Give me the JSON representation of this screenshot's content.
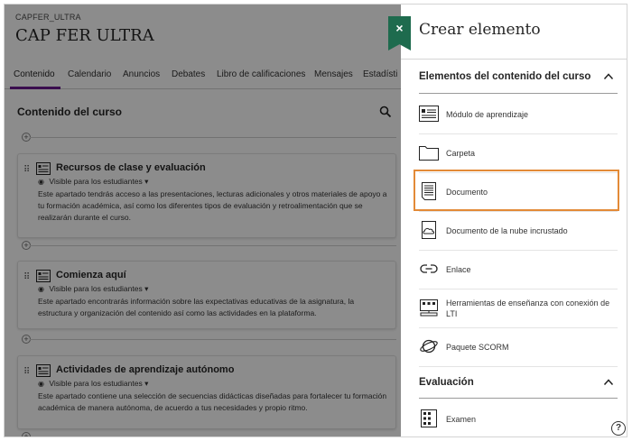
{
  "course": {
    "code": "CAPFER_ULTRA",
    "title": "CAP FER ULTRA",
    "nav": [
      "Contenido",
      "Calendario",
      "Anuncios",
      "Debates",
      "Libro de calificaciones",
      "Mensajes",
      "Estadísti"
    ],
    "section_title": "Contenido del curso",
    "items": [
      {
        "title": "Recursos de clase y evaluación",
        "visibility": "Visible para los estudiantes",
        "description": "Este apartado tendrás acceso a las presentaciones, lecturas adicionales y otros materiales de apoyo a tu formación académica, así como los diferentes tipos de evaluación y retroalimentación que se realizarán durante el curso."
      },
      {
        "title": "Comienza aquí",
        "visibility": "Visible para los estudiantes",
        "description": "Este apartado encontrarás información sobre las expectativas educativas de la asignatura, la estructura y organización del contenido así como las actividades en la plataforma."
      },
      {
        "title": "Actividades de aprendizaje autónomo",
        "visibility": "Visible para los estudiantes",
        "description": "Este apartado contiene una selección de secuencias didácticas diseñadas para fortalecer tu formación académica de manera autónoma, de acuerdo a tus necesidades y propio ritmo."
      }
    ]
  },
  "panel": {
    "close_label": "×",
    "title": "Crear elemento",
    "group1": "Elementos del contenido del curso",
    "items": [
      {
        "label": "Módulo de aprendizaje",
        "icon": "learning-module-icon"
      },
      {
        "label": "Carpeta",
        "icon": "folder-icon"
      },
      {
        "label": "Documento",
        "icon": "document-icon"
      },
      {
        "label": "Documento de la nube incrustado",
        "icon": "cloud-document-icon"
      },
      {
        "label": "Enlace",
        "icon": "link-icon"
      },
      {
        "label": "Herramientas de enseñanza con conexión de LTI",
        "icon": "lti-tool-icon"
      },
      {
        "label": "Paquete SCORM",
        "icon": "scorm-icon"
      }
    ],
    "group2": "Evaluación",
    "eval_items": [
      {
        "label": "Examen",
        "icon": "test-icon"
      }
    ],
    "help_label": "?"
  },
  "colors": {
    "accent_green": "#1e6b4e",
    "highlight_orange": "#e38a37",
    "nav_active": "#6a1b8f"
  }
}
